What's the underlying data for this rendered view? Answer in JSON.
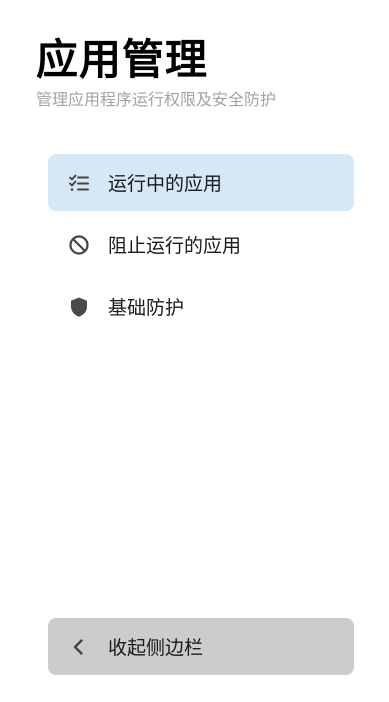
{
  "header": {
    "title": "应用管理",
    "subtitle": "管理应用程序运行权限及安全防护"
  },
  "nav": {
    "items": [
      {
        "label": "运行中的应用",
        "icon": "checklist-icon",
        "active": true
      },
      {
        "label": "阻止运行的应用",
        "icon": "block-icon",
        "active": false
      },
      {
        "label": "基础防护",
        "icon": "shield-icon",
        "active": false
      }
    ]
  },
  "footer": {
    "collapse_label": "收起侧边栏",
    "collapse_icon": "chevron-left-icon"
  },
  "colors": {
    "active_bg": "#d6e8f6",
    "collapse_bg": "#cccccc",
    "icon_color": "#444444",
    "subtitle_color": "#a3a3a3"
  }
}
